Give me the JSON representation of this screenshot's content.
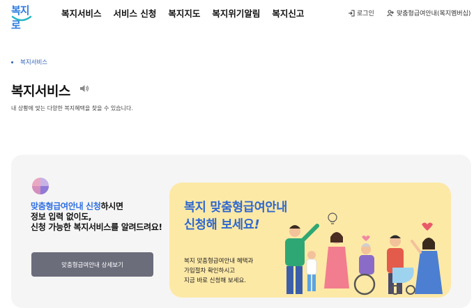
{
  "header": {
    "logo_text": "복지로",
    "nav": [
      "복지서비스",
      "서비스 신청",
      "복지지도",
      "복지위기알림",
      "복지신고"
    ],
    "login_label": "로그인",
    "guide_label": "맞춤형급여안내(복지멤버십)"
  },
  "breadcrumb": "복지서비스",
  "page": {
    "title": "복지서비스",
    "description": "내 상황에 맞는 다양한 복지혜택을 찾을 수 있습니다."
  },
  "intro": {
    "highlight": "맞춤형급여안내 신청",
    "line1_rest": "하시면",
    "line2": "정보 입력 없이도,",
    "line3": "신청 가능한 복지서비스를 알려드려요!",
    "button_label": "맞춤형급여안내 상세보기"
  },
  "banner": {
    "title_line1": "복지 맞춤형급여안내",
    "title_line2_text": "신청해 보세요",
    "title_line2_mark": "!",
    "sub_line1": "복지 맞춤형급여안내 혜택과",
    "sub_line2": "가입절차 확인하시고",
    "sub_line3": "지금 바로 신청해 보세요."
  },
  "colors": {
    "accent_blue": "#2f6ee0",
    "banner_bg": "#fde9a6",
    "button_bg": "#6b6d7b",
    "card_bg": "#f5f5f5"
  },
  "icons": [
    "speaker-icon",
    "login-icon",
    "user-guide-icon",
    "pie-chart-icon",
    "people-illustration"
  ]
}
